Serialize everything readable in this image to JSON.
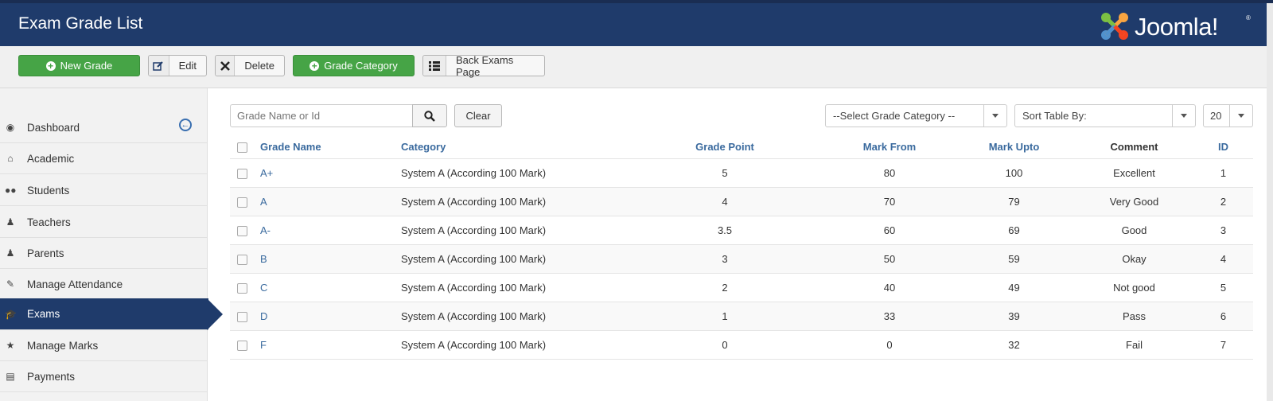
{
  "header": {
    "title": "Exam Grade List",
    "logo_text": "Joomla!",
    "logo_mark": "®"
  },
  "toolbar": {
    "new_grade": "New Grade",
    "edit": "Edit",
    "delete": "Delete",
    "grade_category": "Grade Category",
    "back_exams": "Back Exams Page"
  },
  "sidebar": {
    "items": [
      {
        "label": "Dashboard",
        "icon": "dashboard-icon"
      },
      {
        "label": "Academic",
        "icon": "home-icon"
      },
      {
        "label": "Students",
        "icon": "users-icon"
      },
      {
        "label": "Teachers",
        "icon": "teacher-icon"
      },
      {
        "label": "Parents",
        "icon": "user-icon"
      },
      {
        "label": "Manage Attendance",
        "icon": "pencil-icon"
      },
      {
        "label": "Exams",
        "icon": "graduation-cap-icon",
        "active": true
      },
      {
        "label": "Manage Marks",
        "icon": "star-icon"
      },
      {
        "label": "Payments",
        "icon": "credit-card-icon"
      }
    ]
  },
  "filters": {
    "search_placeholder": "Grade Name or Id",
    "clear": "Clear",
    "category_select": "--Select Grade Category --",
    "sort_select": "Sort Table By:",
    "limit_select": "20"
  },
  "table": {
    "headers": {
      "grade_name": "Grade Name",
      "category": "Category",
      "grade_point": "Grade Point",
      "mark_from": "Mark From",
      "mark_upto": "Mark Upto",
      "comment": "Comment",
      "id": "ID"
    },
    "rows": [
      {
        "grade": "A+",
        "category": "System A (According 100 Mark)",
        "point": "5",
        "from": "80",
        "upto": "100",
        "comment": "Excellent",
        "id": "1"
      },
      {
        "grade": "A",
        "category": "System A (According 100 Mark)",
        "point": "4",
        "from": "70",
        "upto": "79",
        "comment": "Very Good",
        "id": "2"
      },
      {
        "grade": "A-",
        "category": "System A (According 100 Mark)",
        "point": "3.5",
        "from": "60",
        "upto": "69",
        "comment": "Good",
        "id": "3"
      },
      {
        "grade": "B",
        "category": "System A (According 100 Mark)",
        "point": "3",
        "from": "50",
        "upto": "59",
        "comment": "Okay",
        "id": "4"
      },
      {
        "grade": "C",
        "category": "System A (According 100 Mark)",
        "point": "2",
        "from": "40",
        "upto": "49",
        "comment": "Not good",
        "id": "5"
      },
      {
        "grade": "D",
        "category": "System A (According 100 Mark)",
        "point": "1",
        "from": "33",
        "upto": "39",
        "comment": "Pass",
        "id": "6"
      },
      {
        "grade": "F",
        "category": "System A (According 100 Mark)",
        "point": "0",
        "from": "0",
        "upto": "32",
        "comment": "Fail",
        "id": "7"
      }
    ]
  },
  "colors": {
    "header_bg": "#1f3b6b",
    "green": "#46a446",
    "link": "#3a6a9e"
  }
}
